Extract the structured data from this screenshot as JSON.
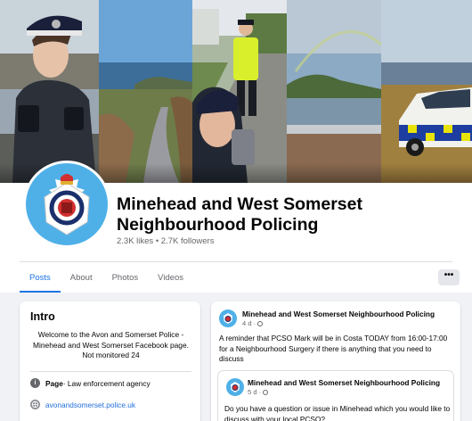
{
  "page": {
    "name": "Minehead and West Somerset Neighbourhood Policing",
    "stats": "2.3K likes • 2.7K followers"
  },
  "tabs": [
    {
      "label": "Posts"
    },
    {
      "label": "About"
    },
    {
      "label": "Photos"
    },
    {
      "label": "Videos"
    }
  ],
  "more_label": "•••",
  "intro": {
    "title": "Intro",
    "bio": "Welcome to the Avon and Somerset Police - Minehead and West Somerset Facebook page. Not monitored 24",
    "category_prefix": "Page",
    "category": " · Law enforcement agency",
    "website": "avonandsomerset.police.uk",
    "category_icon": "info-icon",
    "website_icon": "globe-icon"
  },
  "post": {
    "author": "Minehead and West Somerset Neighbourhood Policing",
    "time": "4 d · ",
    "text": "A reminder that PCSO Mark will be in Costa TODAY from 16:00-17:00 for a Neighbourhood Surgery if there is anything that you need to discuss",
    "shared": {
      "author": "Minehead and West Somerset Neighbourhood Policing",
      "time": "5 d · ",
      "text": "Do you have a question or issue in Minehead which you would like to discuss with your local PCSO?"
    }
  },
  "colors": {
    "accent": "#1b74e4",
    "logo_bg": "#4fb0e8"
  }
}
